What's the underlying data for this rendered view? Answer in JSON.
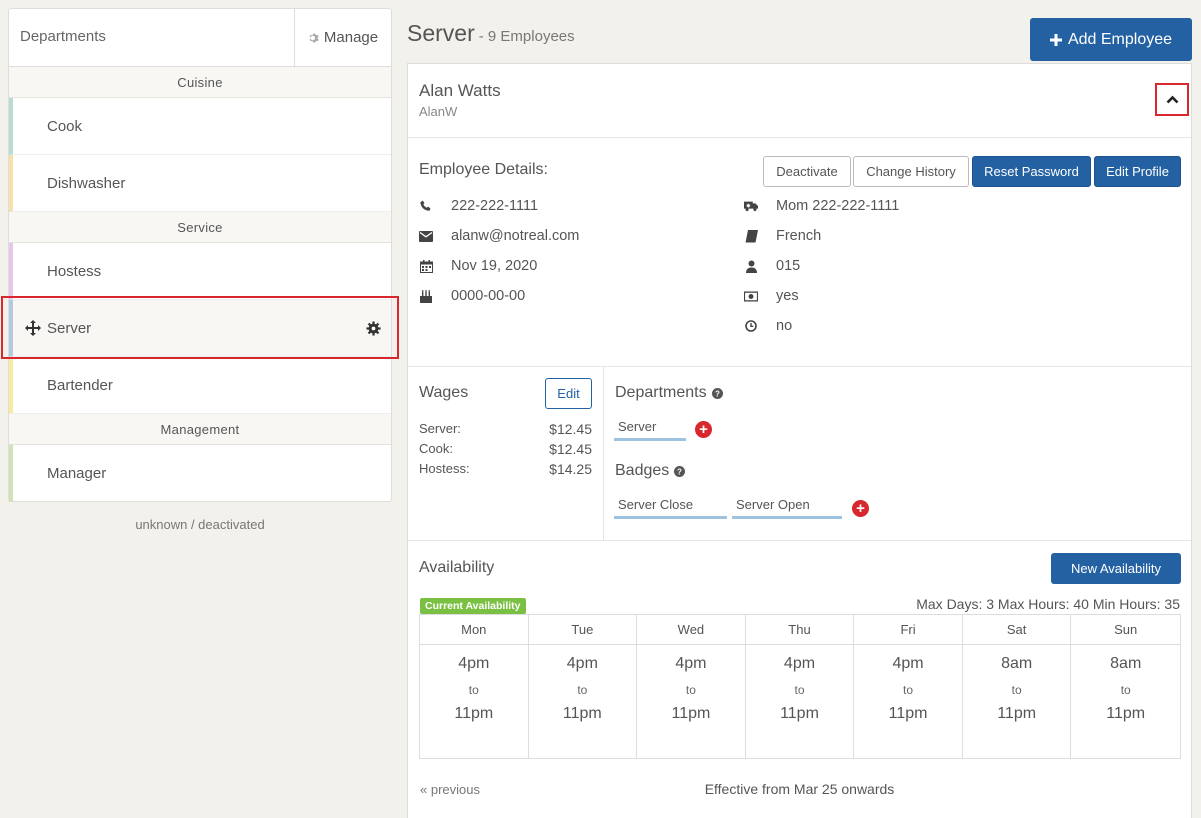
{
  "sidebar": {
    "title": "Departments",
    "manage_label": "Manage",
    "groups": [
      {
        "name": "Cuisine"
      },
      {
        "name": "Service"
      },
      {
        "name": "Management"
      }
    ],
    "items": [
      {
        "label": "Cook",
        "color": "#b8dccf"
      },
      {
        "label": "Dishwasher",
        "color": "#f9e0a8"
      },
      {
        "label": "Hostess",
        "color": "#e6c6ea"
      },
      {
        "label": "Server",
        "color": "#b4c9df"
      },
      {
        "label": "Bartender",
        "color": "#f7eaa3"
      },
      {
        "label": "Manager",
        "color": "#cfe3b4"
      }
    ],
    "unknown_label": "unknown / deactivated"
  },
  "header": {
    "title": "Server",
    "subtitle": "- 9 Employees",
    "add_employee_label": "Add Employee"
  },
  "employee": {
    "name": "Alan Watts",
    "username": "AlanW",
    "details_title": "Employee Details:",
    "buttons": {
      "deactivate": "Deactivate",
      "change_history": "Change History",
      "reset_password": "Reset Password",
      "edit_profile": "Edit Profile"
    },
    "phone": "222-222-1111",
    "email": "alanw@notreal.com",
    "start_date": "Nov 19, 2020",
    "birthday": "0000-00-00",
    "emergency_contact": "Mom 222-222-1111",
    "language": "French",
    "employee_id": "015",
    "cash_flag": "yes",
    "overtime_flag": "no"
  },
  "wages": {
    "title": "Wages",
    "edit_label": "Edit",
    "rows": [
      {
        "dept": "Server:",
        "amount": "$12.45"
      },
      {
        "dept": "Cook:",
        "amount": "$12.45"
      },
      {
        "dept": "Hostess:",
        "amount": "$14.25"
      }
    ]
  },
  "departments": {
    "title": "Departments",
    "tags": [
      "Server"
    ]
  },
  "badges": {
    "title": "Badges",
    "tags": [
      "Server Close",
      "Server Open"
    ]
  },
  "availability": {
    "title": "Availability",
    "new_label": "New Availability",
    "current_badge": "Current Availability",
    "max_info": "Max Days: 3 Max Hours: 40 Min Hours: 35",
    "days": [
      {
        "day": "Mon",
        "start": "4pm",
        "to": "to",
        "end": "11pm"
      },
      {
        "day": "Tue",
        "start": "4pm",
        "to": "to",
        "end": "11pm"
      },
      {
        "day": "Wed",
        "start": "4pm",
        "to": "to",
        "end": "11pm"
      },
      {
        "day": "Thu",
        "start": "4pm",
        "to": "to",
        "end": "11pm"
      },
      {
        "day": "Fri",
        "start": "4pm",
        "to": "to",
        "end": "11pm"
      },
      {
        "day": "Sat",
        "start": "8am",
        "to": "to",
        "end": "11pm"
      },
      {
        "day": "Sun",
        "start": "8am",
        "to": "to",
        "end": "11pm"
      }
    ],
    "previous_label": "« previous",
    "effective_label": "Effective from Mar 25 onwards"
  }
}
